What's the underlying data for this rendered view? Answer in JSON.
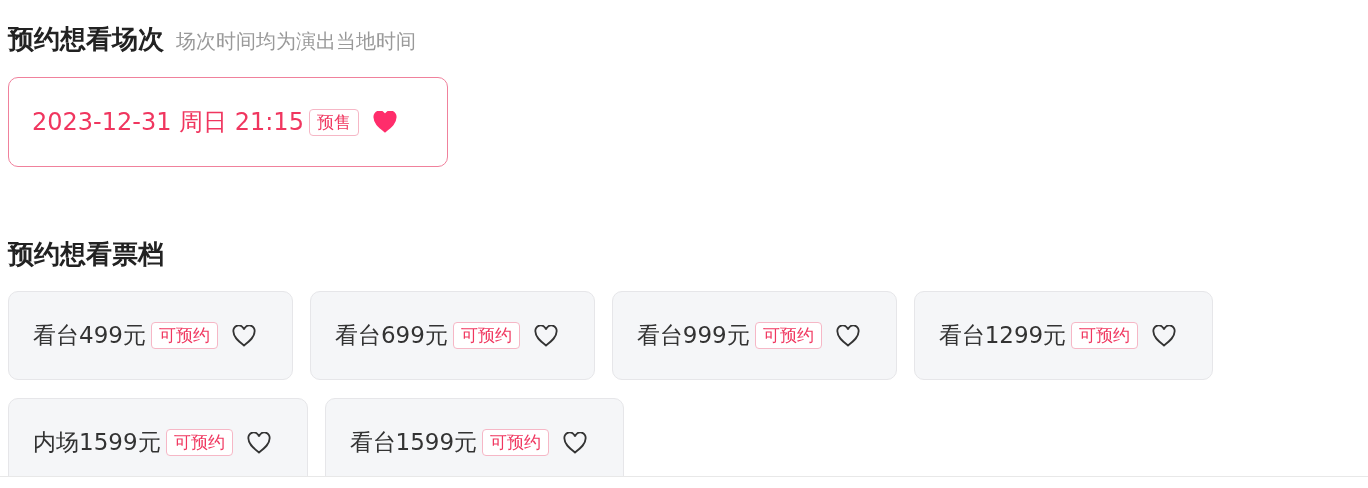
{
  "session_section": {
    "title": "预约想看场次",
    "note": "场次时间均为演出当地时间",
    "sessions": [
      {
        "label": "2023-12-31 周日 21:15",
        "tag": "预售",
        "selected": true
      }
    ]
  },
  "ticket_section": {
    "title": "预约想看票档",
    "tickets": [
      {
        "label": "看台499元",
        "tag": "可预约",
        "selected": false
      },
      {
        "label": "看台699元",
        "tag": "可预约",
        "selected": false
      },
      {
        "label": "看台999元",
        "tag": "可预约",
        "selected": false
      },
      {
        "label": "看台1299元",
        "tag": "可预约",
        "selected": false
      },
      {
        "label": "内场1599元",
        "tag": "可预约",
        "selected": false
      },
      {
        "label": "看台1599元",
        "tag": "可预约",
        "selected": false
      }
    ]
  }
}
